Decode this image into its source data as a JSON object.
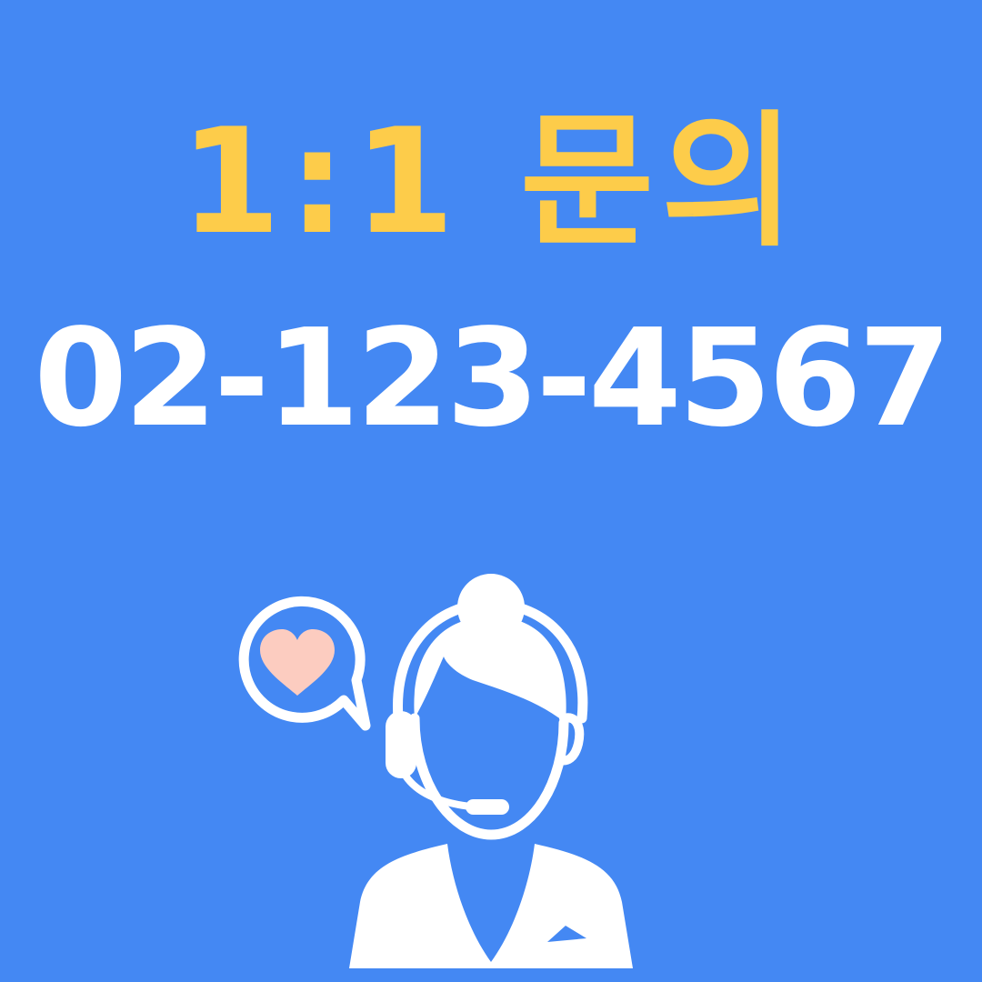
{
  "heading": {
    "title": "1:1 문의",
    "phone": "02-123-4567"
  },
  "icons": {
    "speech_bubble": "heart-speech-bubble-icon",
    "heart": "heart-icon",
    "agent": "customer-service-agent-icon"
  },
  "colors": {
    "background": "#4488f3",
    "title": "#fdcc4a",
    "phone": "#ffffff",
    "heart": "#fcccc0"
  }
}
